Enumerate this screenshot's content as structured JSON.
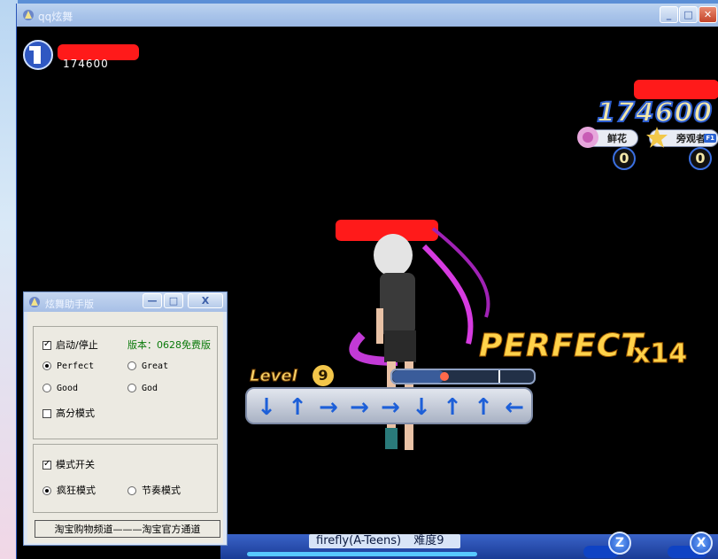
{
  "window": {
    "title": "qq炫舞",
    "buttons": {
      "minimize": "_",
      "maximize": "□",
      "close": "✕"
    }
  },
  "game": {
    "player_score": "174600",
    "big_score": "174600",
    "flowers_label": "鲜花",
    "spectators_label": "旁观者",
    "spectators_key": "F1",
    "flowers_count": "0",
    "spectators_count": "0",
    "level_label": "Level",
    "level_value": "9",
    "progress": 0.38,
    "judgement": "PERFECT",
    "combo": "x14",
    "arrows": [
      "↓",
      "↑",
      "→",
      "→",
      "→",
      "↓",
      "↑",
      "↑",
      "←"
    ],
    "song_title": "firefly(A-Teens)",
    "difficulty": "难度9",
    "z_button": "Z",
    "x_button": "X"
  },
  "tool": {
    "title": "炫舞助手版",
    "buttons": {
      "minimize": "—",
      "maximize": "□",
      "close": "X"
    },
    "start_stop_label": "启动/停止",
    "version_label": "版本：0628免费版",
    "options": {
      "perfect": "Perfect",
      "great": "Great",
      "good": "Good",
      "god": "God"
    },
    "high_score_label": "高分模式",
    "mode_switch_label": "模式开关",
    "crazy_mode_label": "疯狂模式",
    "rhythm_mode_label": "节奏模式",
    "link_label": "淘宝购物频道———淘宝官方通道"
  }
}
